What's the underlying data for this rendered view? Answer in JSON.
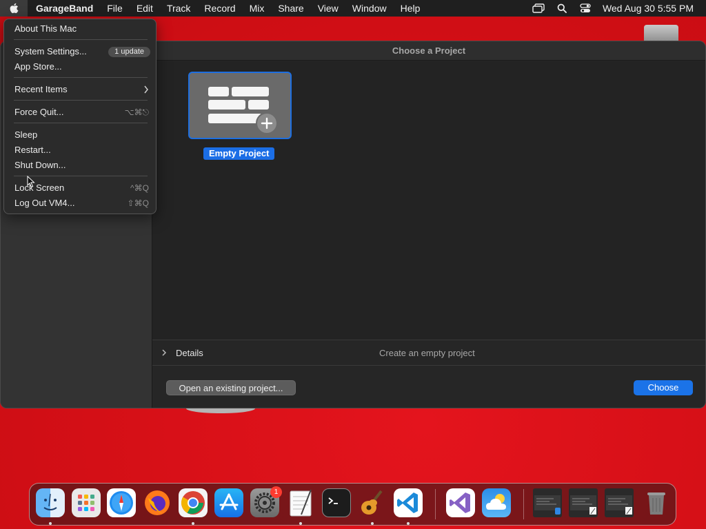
{
  "menubar": {
    "apple_icon": "apple-logo-icon",
    "app_name": "GarageBand",
    "menus": [
      "File",
      "Edit",
      "Track",
      "Record",
      "Mix",
      "Share",
      "View",
      "Window",
      "Help"
    ],
    "status_icons": [
      "screen-mirroring-icon",
      "spotlight-search-icon",
      "control-center-icon"
    ],
    "clock": "Wed Aug 30  5:55 PM"
  },
  "apple_menu": {
    "about": "About This Mac",
    "system_settings": "System Settings...",
    "system_settings_badge": "1 update",
    "app_store": "App Store...",
    "recent_items": "Recent Items",
    "force_quit": "Force Quit...",
    "force_quit_shortcut": "⌥⌘⎋",
    "sleep": "Sleep",
    "restart": "Restart...",
    "shut_down": "Shut Down...",
    "lock_screen": "Lock Screen",
    "lock_screen_shortcut": "^⌘Q",
    "log_out": "Log Out VM4...",
    "log_out_shortcut": "⇧⌘Q"
  },
  "window": {
    "title": "Choose a Project",
    "template": {
      "label": "Empty Project",
      "icon": "empty-project-icon"
    },
    "details": {
      "label": "Details",
      "description": "Create an empty project"
    },
    "open_existing_label": "Open an existing project...",
    "choose_label": "Choose"
  },
  "dock": {
    "apps": [
      {
        "name": "Finder",
        "icon": "finder-icon",
        "running": true
      },
      {
        "name": "Launchpad",
        "icon": "launchpad-icon",
        "running": false
      },
      {
        "name": "Safari",
        "icon": "safari-icon",
        "running": false
      },
      {
        "name": "Firefox",
        "icon": "firefox-icon",
        "running": false
      },
      {
        "name": "Google Chrome",
        "icon": "chrome-icon",
        "running": true
      },
      {
        "name": "App Store",
        "icon": "app-store-icon",
        "running": false
      },
      {
        "name": "System Settings",
        "icon": "system-settings-icon",
        "running": false
      },
      {
        "name": "TextEdit",
        "icon": "textedit-icon",
        "running": true
      },
      {
        "name": "Terminal",
        "icon": "terminal-icon",
        "running": false
      },
      {
        "name": "GarageBand",
        "icon": "garageband-icon",
        "running": true
      },
      {
        "name": "Visual Studio Code",
        "icon": "vscode-icon",
        "running": true
      },
      {
        "name": "Visual Studio",
        "icon": "visual-studio-icon",
        "running": false
      },
      {
        "name": "iCloud",
        "icon": "icloud-icon",
        "running": false
      }
    ],
    "system_settings_badge": "1",
    "recent_items": [
      "recent-window-thumbnail-icon",
      "recent-document-thumbnail-icon",
      "recent-document-thumbnail-icon"
    ],
    "trash": "trash-icon"
  }
}
